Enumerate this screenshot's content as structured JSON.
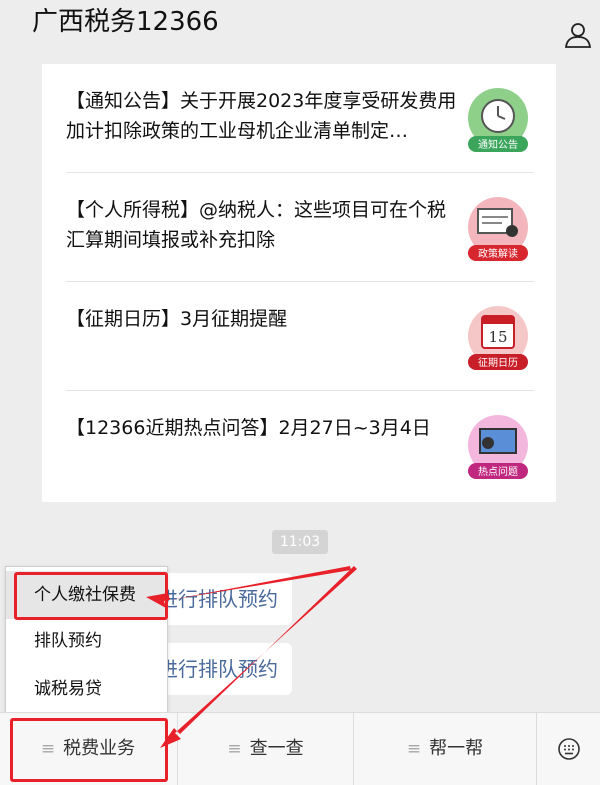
{
  "header": {
    "title": "广西税务12366"
  },
  "articles": [
    {
      "text": "【通知公告】关于开展2023年度享受研发费用加计扣除政策的工业母机企业清单制定…",
      "badge": "通知公告",
      "badge_color": "#3ba55c"
    },
    {
      "text": "【个人所得税】@纳税人：这些项目可在个税汇算期间填报或补充扣除",
      "badge": "政策解读",
      "badge_color": "#d7262d"
    },
    {
      "text": "【征期日历】3月征期提醒",
      "badge": "征期日历",
      "badge_color": "#c81e28",
      "calendar_day": "15"
    },
    {
      "text": "【12366近期热点问答】2月27日~3月4日",
      "badge": "热点问题",
      "badge_color": "#c0287f"
    }
  ],
  "time_badge": "11:03",
  "bubbles": [
    {
      "text": "进行排队预约"
    },
    {
      "text": "进行排队预约"
    }
  ],
  "popup_menu": {
    "items": [
      {
        "label": "个人缴社保费",
        "active": true
      },
      {
        "label": "排队预约",
        "active": false
      },
      {
        "label": "诚税易贷",
        "active": false
      }
    ]
  },
  "bottom_menu": {
    "items": [
      {
        "label": "税费业务"
      },
      {
        "label": "查一查"
      },
      {
        "label": "帮一帮"
      }
    ],
    "menu_icon": "hamburger-icon",
    "keyboard_icon": "keyboard-icon"
  },
  "annotation_color": "#e8202a"
}
